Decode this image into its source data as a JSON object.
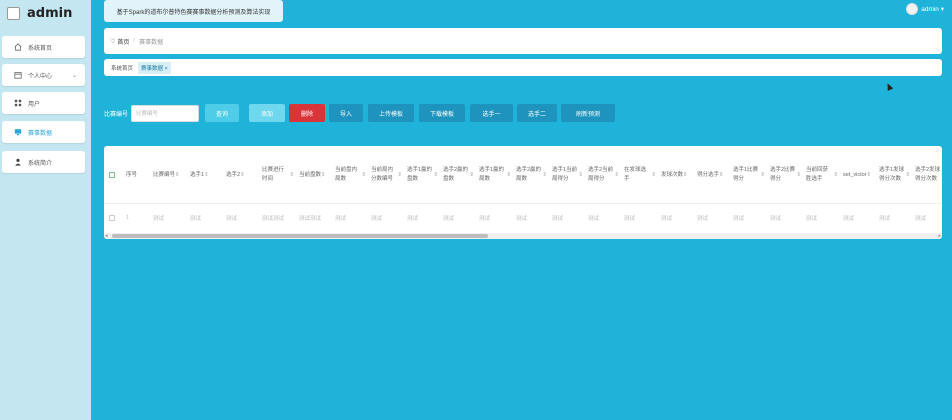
{
  "app": {
    "brand": "admin",
    "title": "基于Spark的道布尔普特色赛赛事数据分析预测及算法实现",
    "user_name": "admin ▾"
  },
  "sidebar": {
    "items": [
      {
        "label": "系统首页",
        "icon": "home-icon"
      },
      {
        "label": "个人中心",
        "icon": "calendar-icon"
      },
      {
        "label": "用户",
        "icon": "grid-icon"
      },
      {
        "label": "赛事数据",
        "icon": "monitor-icon"
      },
      {
        "label": "系统简介",
        "icon": "person-icon"
      }
    ]
  },
  "breadcrumb": {
    "home": "首页",
    "sep": "/",
    "current": "赛事数据"
  },
  "tags": {
    "home": "系统首页",
    "active": "赛事数据 ×"
  },
  "search": {
    "label": "比赛编号",
    "placeholder": "比赛编号"
  },
  "buttons": {
    "query": "查询",
    "add": "添加",
    "delete": "删除",
    "import": "导入",
    "upload_template": "上传模板",
    "download_template": "下载模板",
    "player1": "选手一",
    "player2": "选手二",
    "forecast": "刷新预测"
  },
  "colors": {
    "accent": "#1fb3d9",
    "query_btn": "#4fcde8",
    "add_btn": "#6fd8ee",
    "delete_btn": "#d9343a",
    "dark_btn": "#1d93bd"
  },
  "table": {
    "columns": [
      {
        "label": "序号",
        "sortable": false
      },
      {
        "label": "比赛编号",
        "sortable": true
      },
      {
        "label": "选手1",
        "sortable": true
      },
      {
        "label": "选手2",
        "sortable": true
      },
      {
        "label": "比赛进行时间",
        "sortable": true
      },
      {
        "label": "当前盘数",
        "sortable": true
      },
      {
        "label": "当前盘内局数",
        "sortable": true
      },
      {
        "label": "当前局内分数编号",
        "sortable": true
      },
      {
        "label": "选手1赢的盘数",
        "sortable": true
      },
      {
        "label": "选手2赢的盘数",
        "sortable": true
      },
      {
        "label": "选手1赢的局数",
        "sortable": true
      },
      {
        "label": "选手2赢的局数",
        "sortable": true
      },
      {
        "label": "选手1当前局得分",
        "sortable": true
      },
      {
        "label": "选手2当前局得分",
        "sortable": true
      },
      {
        "label": "在发球选手",
        "sortable": true
      },
      {
        "label": "发球次数",
        "sortable": true
      },
      {
        "label": "得分选手",
        "sortable": true
      },
      {
        "label": "选手1比赛得分",
        "sortable": true
      },
      {
        "label": "选手2比赛得分",
        "sortable": true
      },
      {
        "label": "当前回获胜选手",
        "sortable": true
      },
      {
        "label": "set_victor",
        "sortable": true
      },
      {
        "label": "选手1发球得分次数",
        "sortable": true
      },
      {
        "label": "选手2发球得分次数",
        "sortable": true
      }
    ],
    "rows": [
      {
        "index": "1",
        "cells": [
          "测试",
          "测试",
          "测试",
          "测试测试",
          "测试测试",
          "测试",
          "测试",
          "测试",
          "测试",
          "测试",
          "测试",
          "测试",
          "测试",
          "测试",
          "测试",
          "测试",
          "测试",
          "测试",
          "测试",
          "测试",
          "测试",
          "测试"
        ]
      }
    ]
  }
}
